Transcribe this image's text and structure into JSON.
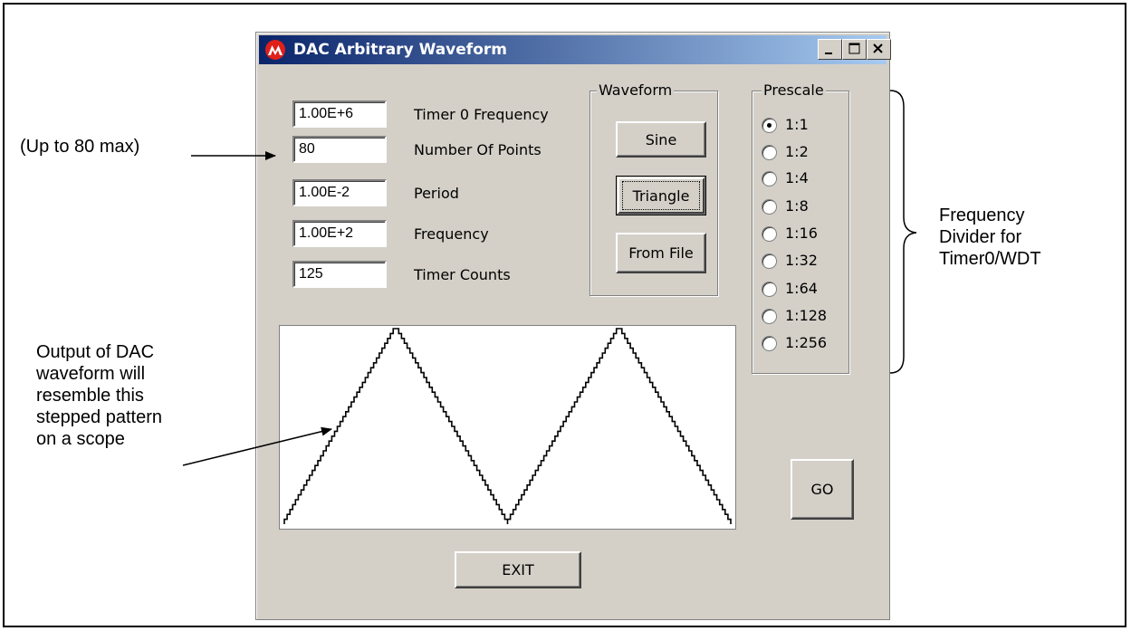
{
  "window": {
    "title": "DAC Arbitrary Waveform",
    "controls": {
      "minimize": "_",
      "maximize": "□",
      "close": "X"
    }
  },
  "fields": [
    {
      "value": "1.00E+6",
      "label": "Timer 0 Frequency"
    },
    {
      "value": "80",
      "label": "Number Of Points"
    },
    {
      "value": "1.00E-2",
      "label": "Period"
    },
    {
      "value": "1.00E+2",
      "label": "Frequency"
    },
    {
      "value": "125",
      "label": "Timer Counts"
    }
  ],
  "waveform_group": {
    "title": "Waveform",
    "buttons": [
      "Sine",
      "Triangle",
      "From File"
    ],
    "selected": "Triangle"
  },
  "prescale_group": {
    "title": "Prescale",
    "options": [
      "1:1",
      "1:2",
      "1:4",
      "1:8",
      "1:16",
      "1:32",
      "1:64",
      "1:128",
      "1:256"
    ],
    "selected": "1:1"
  },
  "buttons": {
    "go": "GO",
    "exit": "EXIT"
  },
  "scope": {
    "waveform": "triangle",
    "cycles": 2,
    "stepped": true
  },
  "annotations": {
    "points_note": "(Up to 80 max)",
    "output_note": [
      "Output of DAC",
      "waveform will",
      "resemble this",
      "stepped pattern",
      "on a scope"
    ],
    "prescale_note": [
      "Frequency",
      "Divider for",
      "Timer0/WDT"
    ]
  }
}
